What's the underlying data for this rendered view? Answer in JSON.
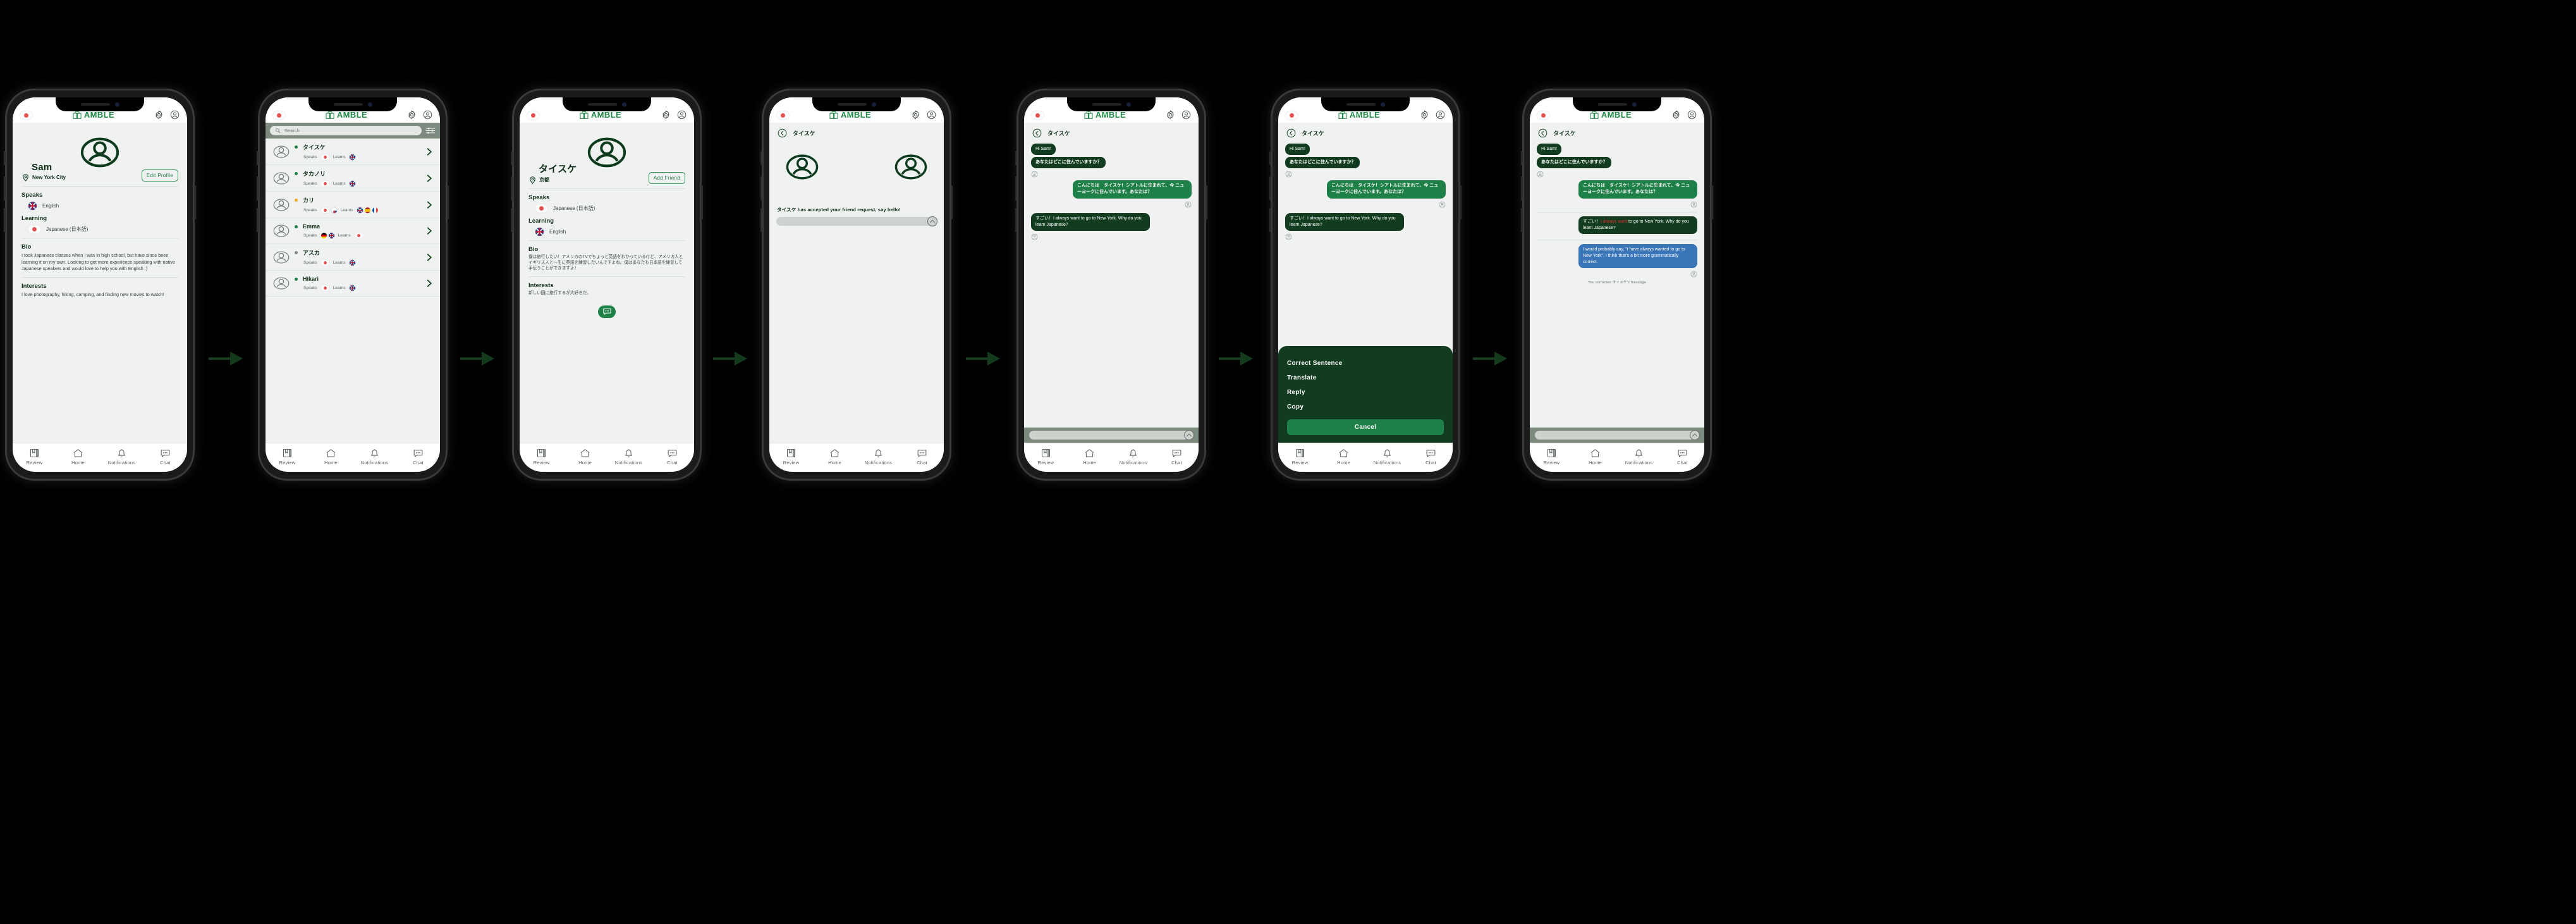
{
  "app": {
    "name": "AMBLE",
    "accent_green": "#1f8b46",
    "dark_green": "#123c20",
    "bubble_green": "#1f8047",
    "bubble_blue": "#3a75b8",
    "error_red": "#e03030",
    "header_flag": "japan-flag",
    "icons": [
      "book-logo-icon",
      "gear-icon",
      "account-icon"
    ]
  },
  "tabbar": {
    "items": [
      {
        "label": "Review",
        "icon": "review-book-icon"
      },
      {
        "label": "Home",
        "icon": "home-icon"
      },
      {
        "label": "Notifications",
        "icon": "bell-icon"
      },
      {
        "label": "Chat",
        "icon": "chat-bubble-icon"
      }
    ]
  },
  "screens": [
    {
      "id": "my-profile",
      "name": "Sam",
      "location": "New York City",
      "action_label": "Edit Profile",
      "speaks_title": "Speaks",
      "speaks": [
        {
          "flag": "uk",
          "label": "English"
        }
      ],
      "learning_title": "Learning",
      "learning": [
        {
          "flag": "jp",
          "label": "Japanese (日本語)"
        }
      ],
      "bio_title": "Bio",
      "bio": "I took Japanese classes when I was in high school, but have since been learning it on my own. Looking to get more experience speaking with native Japanese speakers and would love to help you with English :)",
      "interests_title": "Interests",
      "interests": "I love photography, hiking, camping, and finding new movies to watch!"
    },
    {
      "id": "browse-users",
      "search_placeholder": "Search",
      "filter_icon": "filter-sliders-icon",
      "speaks_label": "Speaks",
      "learns_label": "Learns",
      "users": [
        {
          "name": "タイスケ",
          "status": "online",
          "status_color": "#1f8047",
          "speaks": [
            "jp"
          ],
          "learns": [
            "uk"
          ]
        },
        {
          "name": "タカノリ",
          "status": "online",
          "status_color": "#1f8047",
          "speaks": [
            "jp"
          ],
          "learns": [
            "uk"
          ]
        },
        {
          "name": "カリ",
          "status": "away",
          "status_color": "#f0a81e",
          "speaks": [
            "jp",
            "kr"
          ],
          "learns": [
            "uk",
            "es",
            "fr"
          ]
        },
        {
          "name": "Emma",
          "status": "online",
          "status_color": "#1f8047",
          "speaks": [
            "de",
            "uk"
          ],
          "learns": [
            "jp"
          ]
        },
        {
          "name": "アスカ",
          "status": "offline",
          "status_color": "#7d8a80",
          "speaks": [
            "jp"
          ],
          "learns": [
            "uk"
          ]
        },
        {
          "name": "Hikari",
          "status": "online",
          "status_color": "#1f8047",
          "speaks": [
            "jp"
          ],
          "learns": [
            "uk"
          ]
        }
      ]
    },
    {
      "id": "other-profile",
      "name": "タイスケ",
      "location": "京都",
      "action_label": "Add Friend",
      "speaks_title": "Speaks",
      "speaks": [
        {
          "flag": "jp",
          "label": "Japanese (日本語)"
        }
      ],
      "learning_title": "Learning",
      "learning": [
        {
          "flag": "uk",
          "label": "English"
        }
      ],
      "bio_title": "Bio",
      "bio": "僕は旅行したい！アメリカのTVでちょっと英語をわかっているけど、アメリカ人とイギリス人と一生に英語を練習したいんですよね。僕はあなたも日本語を練習して手伝うことができますよ！",
      "interests_title": "Interests",
      "interests": "新しい国に旅行するが大好きだ。",
      "chat_fab_icon": "chat-bubble-icon"
    },
    {
      "id": "friend-accepted",
      "title": "タイスケ",
      "back_icon": "back-chevron-icon",
      "message": "タイスケ has accepted your friend request, say hello!",
      "send_icon": "send-up-icon"
    },
    {
      "id": "chat",
      "title": "タイスケ",
      "back_icon": "back-chevron-icon",
      "send_icon": "send-up-icon",
      "messages": [
        {
          "from": "them",
          "style": "dark",
          "text": "Hi Sam!"
        },
        {
          "from": "them",
          "style": "dark",
          "jp": true,
          "text": "あなたはどこに住んでいますか？"
        },
        {
          "from": "me",
          "style": "green",
          "jp": true,
          "text": "こんにちは　タイスケ！シアトルに生まれて、今 ニューヨークに住んでいます。あなたは？"
        },
        {
          "from": "them",
          "style": "dark",
          "text": "すごい！I always want to go to New York. Why do you learn Japanese?"
        }
      ]
    },
    {
      "id": "chat-actions",
      "title": "タイスケ",
      "back_icon": "back-chevron-icon",
      "sheet": {
        "items": [
          "Correct Sentence",
          "Translate",
          "Reply",
          "Copy"
        ],
        "cancel_label": "Cancel"
      }
    },
    {
      "id": "chat-corrected",
      "title": "タイスケ",
      "back_icon": "back-chevron-icon",
      "send_icon": "send-up-icon",
      "corrected_message": {
        "prefix": "すごい！",
        "error": "I always want",
        "suffix": " to go to New York. Why do you learn Japanese?"
      },
      "correction_bubble": "I would probably say, “I have always wanted to go to New York”. I think that’s a bit more grammatically correct.",
      "correction_note": "You corrected タイスケ’s message"
    }
  ]
}
